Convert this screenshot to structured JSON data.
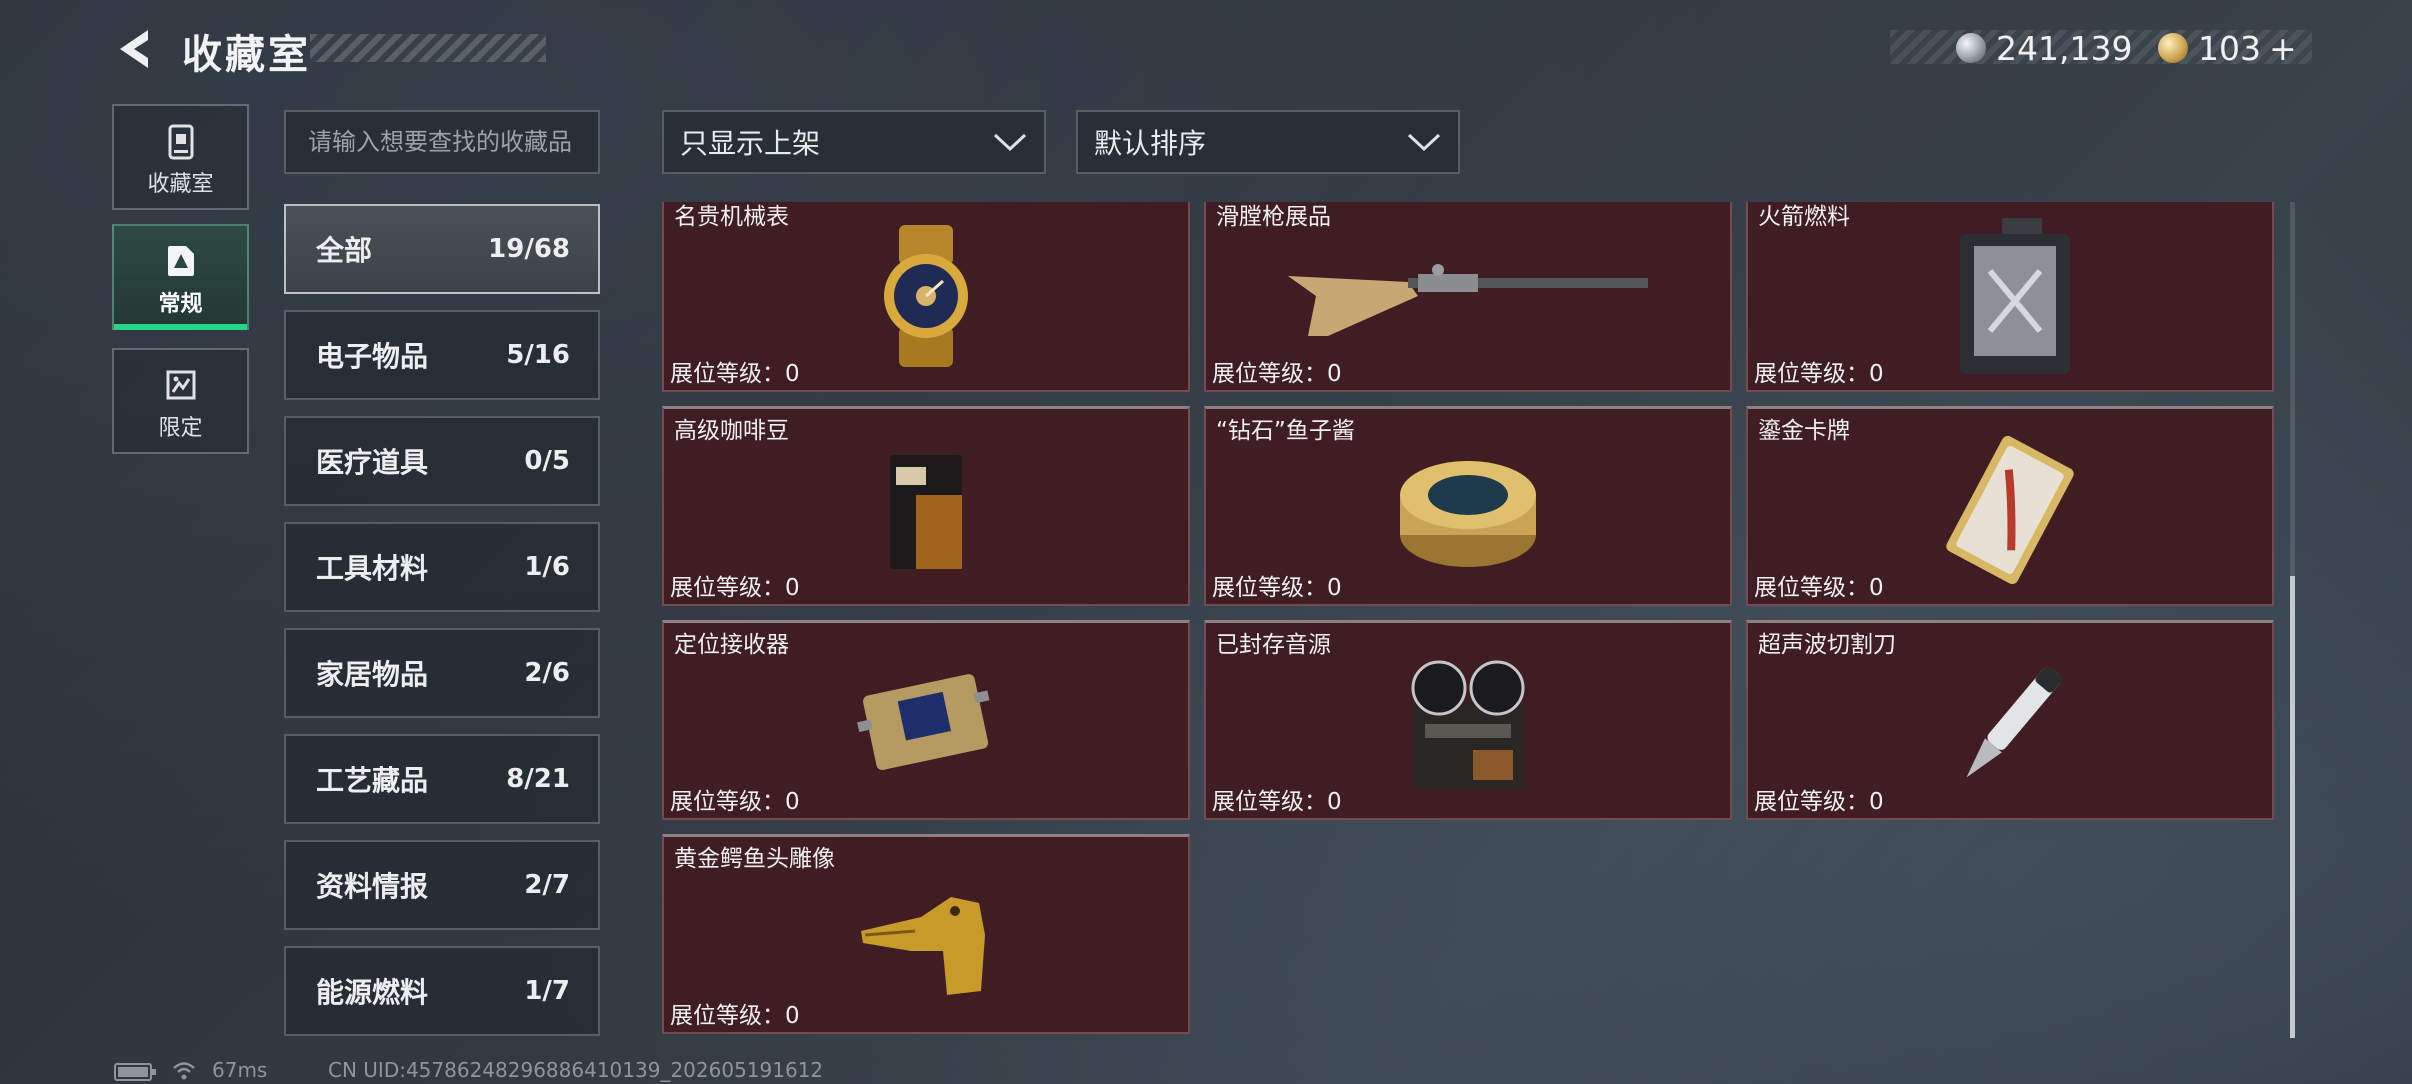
{
  "header": {
    "title": "收藏室"
  },
  "currency": {
    "silver": "241,139",
    "gold": "103",
    "add_symbol": "+"
  },
  "nav": [
    {
      "label": "收藏室",
      "icon": "collection-room-icon"
    },
    {
      "label": "常规",
      "icon": "regular-icon"
    },
    {
      "label": "限定",
      "icon": "limited-icon"
    }
  ],
  "search": {
    "placeholder": "请输入想要查找的收藏品"
  },
  "filters": {
    "display": "只显示上架",
    "sort": "默认排序"
  },
  "categories": [
    {
      "name": "全部",
      "count": "19/68"
    },
    {
      "name": "电子物品",
      "count": "5/16"
    },
    {
      "name": "医疗道具",
      "count": "0/5"
    },
    {
      "name": "工具材料",
      "count": "1/6"
    },
    {
      "name": "家居物品",
      "count": "2/6"
    },
    {
      "name": "工艺藏品",
      "count": "8/21"
    },
    {
      "name": "资料情报",
      "count": "2/7"
    },
    {
      "name": "能源燃料",
      "count": "1/7"
    }
  ],
  "items": [
    {
      "name": "名贵机械表",
      "level": "展位等级：0",
      "icon": "luxury-watch-icon"
    },
    {
      "name": "滑膛枪展品",
      "level": "展位等级：0",
      "icon": "musket-icon"
    },
    {
      "name": "火箭燃料",
      "level": "展位等级：0",
      "icon": "fuel-canister-icon"
    },
    {
      "name": "高级咖啡豆",
      "level": "展位等级：0",
      "icon": "coffee-bag-icon"
    },
    {
      "name": "“钻石”鱼子酱",
      "level": "展位等级：0",
      "icon": "caviar-tin-icon"
    },
    {
      "name": "鎏金卡牌",
      "level": "展位等级：0",
      "icon": "gilded-card-icon"
    },
    {
      "name": "定位接收器",
      "level": "展位等级：0",
      "icon": "locator-receiver-icon"
    },
    {
      "name": "已封存音源",
      "level": "展位等级：0",
      "icon": "reel-recorder-icon"
    },
    {
      "name": "超声波切割刀",
      "level": "展位等级：0",
      "icon": "ultrasonic-cutter-icon"
    },
    {
      "name": "黄金鳄鱼头雕像",
      "level": "展位等级：0",
      "icon": "gold-crocodile-statue-icon"
    }
  ],
  "status": {
    "ping": "67ms",
    "uid": "CN UID:4578624829688641013​9_202605191612"
  }
}
